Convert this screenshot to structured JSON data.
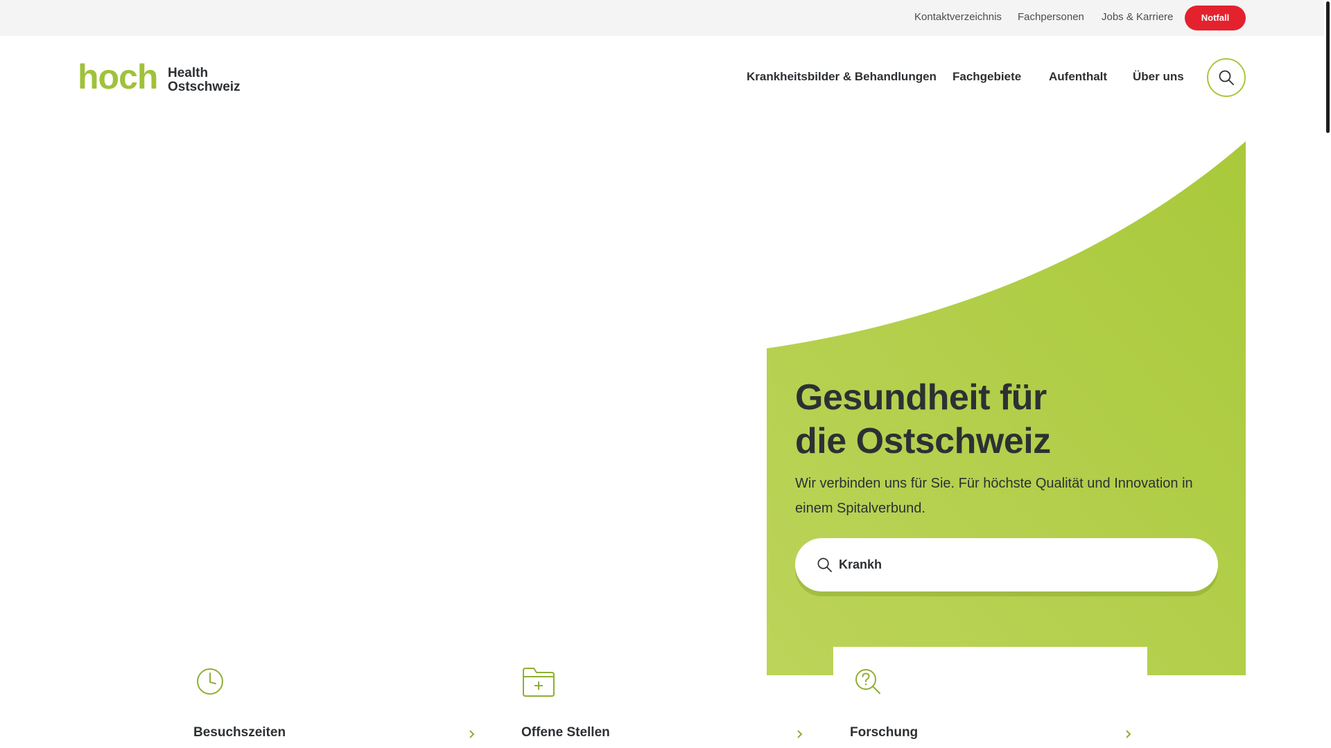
{
  "topbar": {
    "links": [
      "Kontaktverzeichnis",
      "Fachpersonen",
      "Jobs & Karriere"
    ],
    "emergency": "Notfall"
  },
  "logo": {
    "word": "hoch",
    "line1": "Health",
    "line2": "Ostschweiz"
  },
  "nav": {
    "items": [
      "Krankheitsbilder & Behandlungen",
      "Fachgebiete",
      "Aufenthalt",
      "Über uns"
    ],
    "search_icon": "search-icon"
  },
  "hero": {
    "title": "Gesundheit für\ndie Ostschweiz",
    "subtitle": "Wir verbinden uns für Sie. Für höchste Qualität und Innovation in einem Spitalverbund.",
    "search_value": "Krankh"
  },
  "quicklinks": [
    {
      "label": "Besuchszeiten",
      "icon": "clock-icon"
    },
    {
      "label": "Offene Stellen",
      "icon": "folder-plus-icon"
    },
    {
      "label": "Forschung",
      "icon": "search-question-icon"
    }
  ],
  "colors": {
    "brand_green": "#a9c93b",
    "emergency_red": "#e3222d",
    "text_dark": "#2d3033"
  }
}
